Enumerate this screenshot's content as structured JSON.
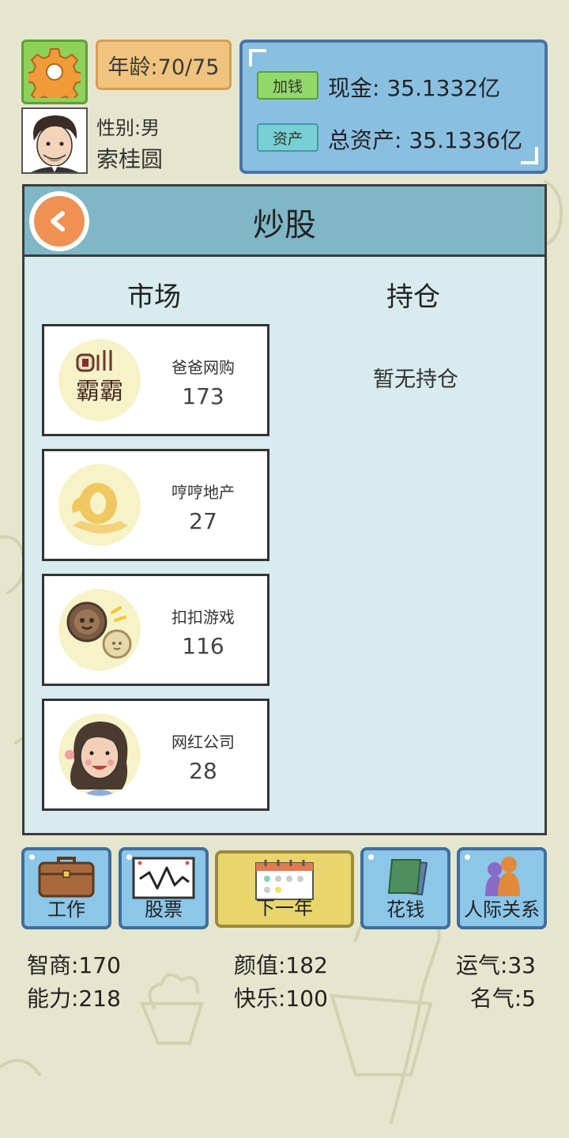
{
  "header": {
    "age": "年龄:70/75",
    "gender": "性别:男",
    "name": "索桂圆"
  },
  "money": {
    "add_button": "加钱",
    "cash": "现金: 35.1332亿",
    "assets_button": "资产",
    "total_assets": "总资产: 35.1336亿"
  },
  "panel": {
    "title": "炒股",
    "market_label": "市场",
    "holdings_label": "持仓",
    "holdings_empty": "暂无持仓"
  },
  "stocks": [
    {
      "name": "爸爸网购",
      "price": "173",
      "logo": "bilibili-badge-icon"
    },
    {
      "name": "哼哼地产",
      "price": "27",
      "logo": "gold-coin-icon"
    },
    {
      "name": "扣扣游戏",
      "price": "116",
      "logo": "buttons-icon"
    },
    {
      "name": "网红公司",
      "price": "28",
      "logo": "girl-face-icon"
    }
  ],
  "nav": {
    "work": "工作",
    "stocks": "股票",
    "next_year": "下一年",
    "spend": "花钱",
    "relations": "人际关系"
  },
  "stats": {
    "iq": "智商:170",
    "looks": "颜值:182",
    "luck": "运气:33",
    "ability": "能力:218",
    "happiness": "快乐:100",
    "fame": "名气:5"
  },
  "colors": {
    "background": "#e6e6cf",
    "panel_bg": "#d8ebee",
    "panel_header": "#7fb7c7",
    "settings_green": "#8ed15a",
    "age_orange": "#f0c47e",
    "money_blue": "#89c0e2",
    "nav_blue": "#8cc6e8",
    "nav_yellow": "#e8d66c"
  }
}
